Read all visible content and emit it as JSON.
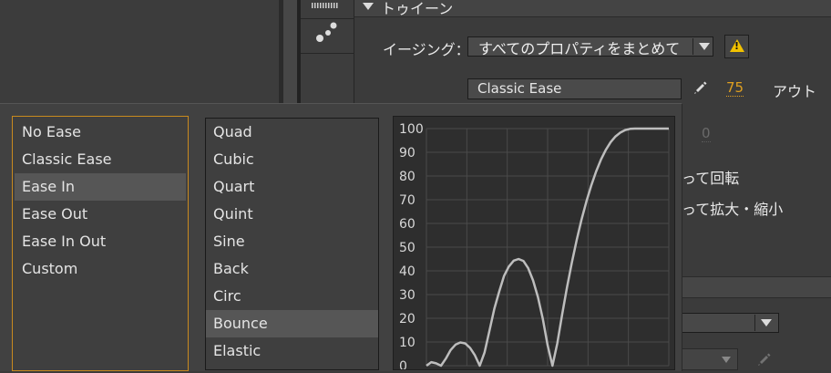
{
  "tween": {
    "section_title": "トゥイーン",
    "easing_label": "イージング：",
    "easing_select": "すべてのプロパティをまとめて",
    "warning_mark": "!",
    "ease_field": "Classic Ease",
    "ease_value": "75",
    "ease_out_label": "アウト",
    "disabled_value": "0",
    "rotate_label": "って回転",
    "scale_label": "って拡大・縮小"
  },
  "ease_types": {
    "items": [
      "No Ease",
      "Classic Ease",
      "Ease In",
      "Ease Out",
      "Ease In Out",
      "Custom"
    ],
    "selected": "Ease In"
  },
  "ease_presets": {
    "items": [
      "Quad",
      "Cubic",
      "Quart",
      "Quint",
      "Sine",
      "Back",
      "Circ",
      "Bounce",
      "Elastic"
    ],
    "selected": "Bounce"
  },
  "colors": {
    "accent": "#c88a1e",
    "value_orange": "#e0a020",
    "warning": "#f2c200",
    "curve": "#bdbdbd",
    "grid": "#4a4a4a"
  },
  "chart_data": {
    "type": "line",
    "title": "",
    "xlabel": "",
    "ylabel": "",
    "ylim": [
      0,
      100
    ],
    "yticks": [
      0,
      10,
      20,
      30,
      40,
      50,
      60,
      70,
      80,
      90,
      100
    ],
    "xlim": [
      0,
      1
    ],
    "grid": true,
    "series": [
      {
        "x": [
          0,
          0.02,
          0.04,
          0.06,
          0.08,
          0.1,
          0.12,
          0.14,
          0.16,
          0.18,
          0.2,
          0.22,
          0.24,
          0.26,
          0.28,
          0.3,
          0.32,
          0.34,
          0.36,
          0.38,
          0.4,
          0.42,
          0.44,
          0.46,
          0.48,
          0.5,
          0.52,
          0.54,
          0.56,
          0.58,
          0.6,
          0.62,
          0.64,
          0.66,
          0.68,
          0.7,
          0.72,
          0.74,
          0.76,
          0.78,
          0.8,
          0.82,
          0.84,
          0.86,
          0.88,
          0.9,
          0.92,
          0.94,
          0.96,
          0.98,
          1.0
        ],
        "values": [
          0,
          1.5,
          1,
          0,
          3,
          6.6,
          8.9,
          9.8,
          9.4,
          7.5,
          4.4,
          0,
          5.6,
          14.8,
          24,
          31.2,
          37.8,
          41.8,
          44.3,
          45,
          44.2,
          41.1,
          36,
          28.9,
          19.8,
          8.6,
          0,
          9.4,
          21.7,
          33.1,
          43.5,
          53,
          61.6,
          69.3,
          76,
          81.9,
          86.9,
          91,
          94.3,
          96.7,
          98.3,
          99.4,
          99.9,
          100,
          100,
          100,
          100,
          100,
          100,
          100,
          100
        ]
      }
    ]
  }
}
